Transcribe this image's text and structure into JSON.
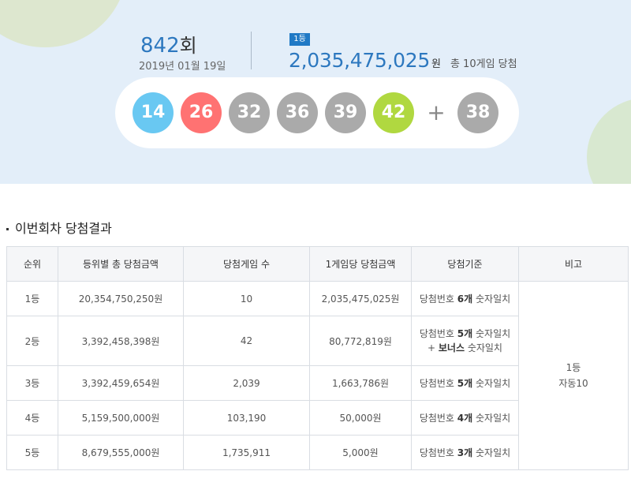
{
  "draw": {
    "round_number": "842",
    "round_suffix": "회",
    "date": "2019년 01월 19일",
    "rank_badge": "1등",
    "first_prize_amount": "2,035,475,025",
    "first_prize_unit": "원",
    "total_games_text": "총 10게임 당첨",
    "balls": [
      {
        "number": "14",
        "color": "#69c8f2"
      },
      {
        "number": "26",
        "color": "#ff7272"
      },
      {
        "number": "32",
        "color": "#aaaaaa"
      },
      {
        "number": "36",
        "color": "#aaaaaa"
      },
      {
        "number": "39",
        "color": "#aaaaaa"
      },
      {
        "number": "42",
        "color": "#b0d840"
      }
    ],
    "plus_sign": "+",
    "bonus_ball": {
      "number": "38",
      "color": "#aaaaaa"
    }
  },
  "section": {
    "title": "이번회차 당첨결과"
  },
  "table": {
    "headers": [
      "순위",
      "등위별 총 당첨금액",
      "당첨게임 수",
      "1게임당 당첨금액",
      "당첨기준",
      "비고"
    ],
    "rows": [
      {
        "rank": "1등",
        "total": "20,354,750,250원",
        "games": "10",
        "per_game": "2,035,475,025원",
        "crit_a": "당첨번호 ",
        "crit_b": "6개",
        "crit_c": " 숫자일치"
      },
      {
        "rank": "2등",
        "total": "3,392,458,398원",
        "games": "42",
        "per_game": "80,772,819원",
        "crit_a": "당첨번호 ",
        "crit_b": "5개",
        "crit_c": " 숫자일치",
        "crit2_a": "+ ",
        "crit2_b": "보너스",
        "crit2_c": " 숫자일치"
      },
      {
        "rank": "3등",
        "total": "3,392,459,654원",
        "games": "2,039",
        "per_game": "1,663,786원",
        "crit_a": "당첨번호 ",
        "crit_b": "5개",
        "crit_c": " 숫자일치"
      },
      {
        "rank": "4등",
        "total": "5,159,500,000원",
        "games": "103,190",
        "per_game": "50,000원",
        "crit_a": "당첨번호 ",
        "crit_b": "4개",
        "crit_c": " 숫자일치"
      },
      {
        "rank": "5등",
        "total": "8,679,555,000원",
        "games": "1,735,911",
        "per_game": "5,000원",
        "crit_a": "당첨번호 ",
        "crit_b": "3개",
        "crit_c": " 숫자일치"
      }
    ],
    "note_line1": "1등",
    "note_line2": "자동10"
  }
}
